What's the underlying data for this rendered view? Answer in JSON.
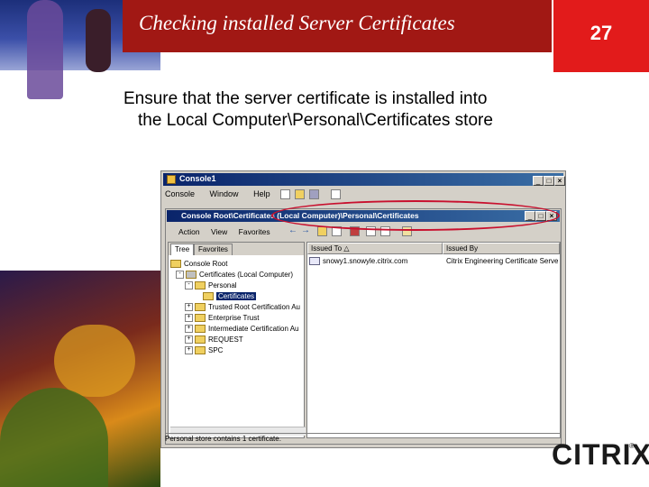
{
  "slide": {
    "title": "Checking installed Server Certificates",
    "page_number": "27",
    "body_line1": "Ensure that the server certificate is installed into",
    "body_line2": "the Local Computer\\Personal\\Certificates store",
    "logo": "CITRIX",
    "logo_mark": "®"
  },
  "window": {
    "title": "Console1",
    "menu": [
      "Console",
      "Window",
      "Help"
    ],
    "controls": [
      "_",
      "□",
      "×"
    ]
  },
  "inner_window": {
    "title": "Console Root\\Certificates (Local Computer)\\Personal\\Certificates",
    "menu": [
      "Action",
      "View",
      "Favorites"
    ],
    "tabs": [
      "Tree",
      "Favorites"
    ],
    "tree": [
      {
        "label": "Console Root",
        "expander": ""
      },
      {
        "label": "Certificates (Local Computer)",
        "expander": "-"
      },
      {
        "label": "Personal",
        "expander": "-"
      },
      {
        "label": "Certificates",
        "expander": ""
      },
      {
        "label": "Trusted Root Certification Au",
        "expander": "+"
      },
      {
        "label": "Enterprise Trust",
        "expander": "+"
      },
      {
        "label": "Intermediate Certification Au",
        "expander": "+"
      },
      {
        "label": "REQUEST",
        "expander": "+"
      },
      {
        "label": "SPC",
        "expander": "+"
      }
    ],
    "columns": [
      "Issued To",
      "Issued By"
    ],
    "sort_indicator": "△",
    "rows": [
      {
        "issued_to": "snowy1.snowyle.citrix.com",
        "issued_by": "Citrix Engineering Certificate Serve"
      }
    ],
    "status": "Personal store contains 1 certificate."
  },
  "colors": {
    "header_red": "#a11814",
    "page_box_red": "#e21b1b",
    "titlebar_blue": "#0a246a",
    "callout_red": "#c8102e"
  }
}
